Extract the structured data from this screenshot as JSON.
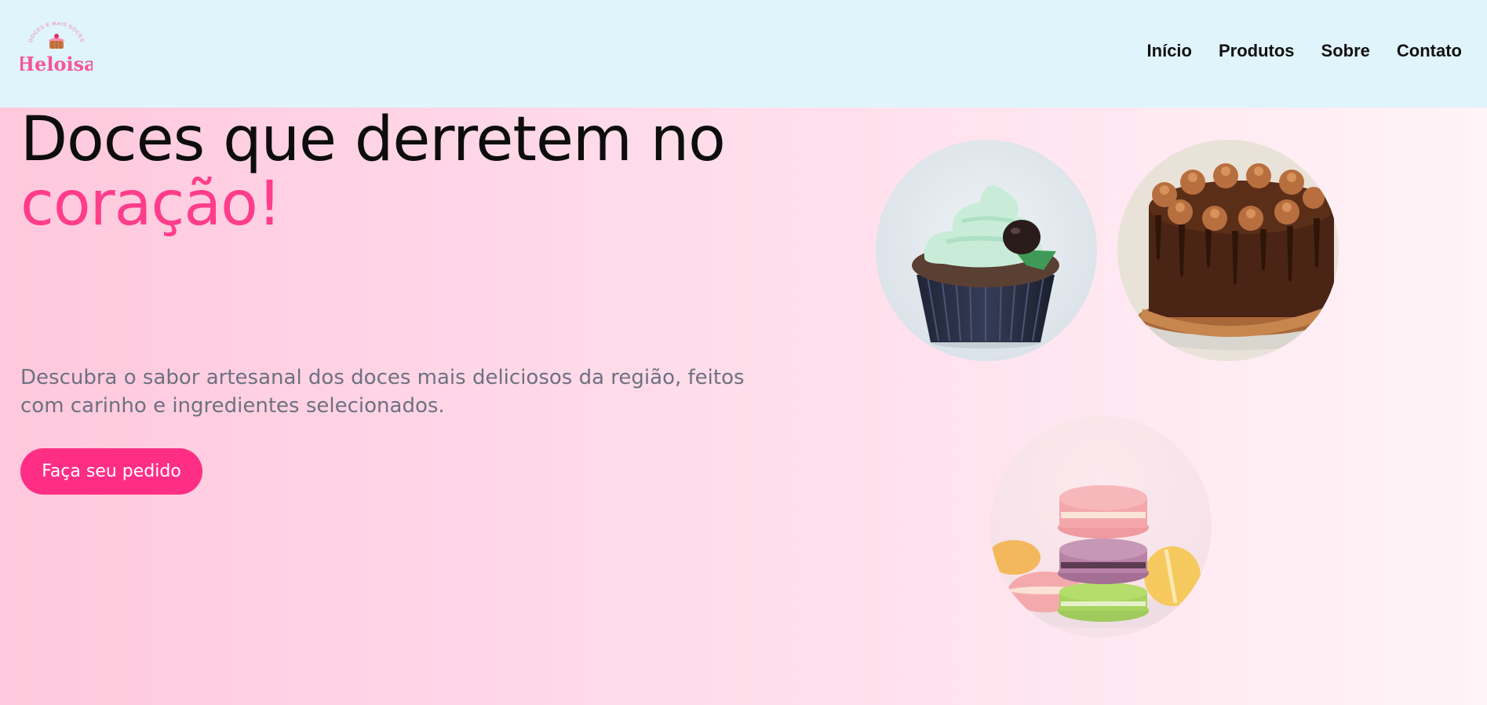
{
  "header": {
    "logo_tagline": "DOCES E MAIS DOCES",
    "logo_name": "Heloisa",
    "nav": [
      {
        "label": "Início"
      },
      {
        "label": "Produtos"
      },
      {
        "label": "Sobre"
      },
      {
        "label": "Contato"
      }
    ]
  },
  "hero": {
    "headline_main": "Doces que derretem no",
    "headline_accent": "coração!",
    "subtitle": "Descubra o sabor artesanal dos doces mais deliciosos da região, feitos com carinho e ingredientes selecionados.",
    "cta_label": "Faça seu pedido"
  },
  "images": [
    {
      "icon": "cupcake-photo"
    },
    {
      "icon": "chocolate-cake-photo"
    },
    {
      "icon": "macarons-photo"
    }
  ],
  "colors": {
    "header_bg": "#e0f4fb",
    "accent": "#ff3d8a",
    "button": "#ff2e85",
    "subtitle_text": "#6d7181"
  }
}
